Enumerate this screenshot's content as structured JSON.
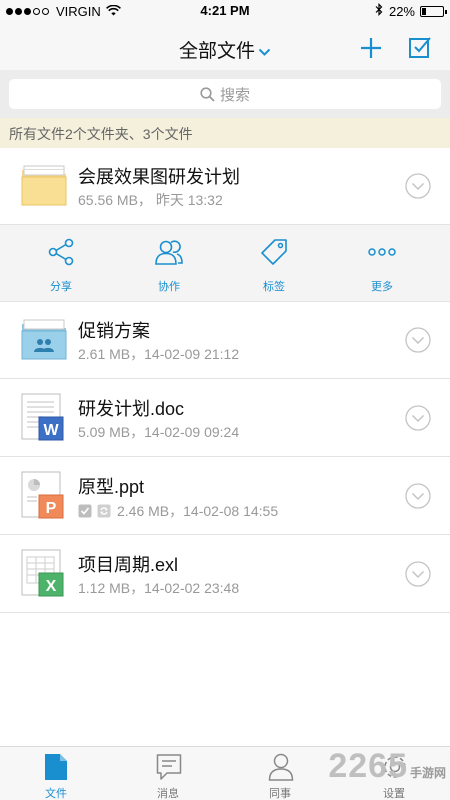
{
  "status_bar": {
    "carrier": "VIRGIN",
    "time": "4:21 PM",
    "battery": "22%"
  },
  "nav": {
    "title": "全部文件",
    "accent": "#1a8fd0"
  },
  "search": {
    "placeholder": "搜索"
  },
  "summary": "所有文件2个文件夹、3个文件",
  "files": [
    {
      "name": "会展效果图研发计划",
      "meta": "65.56 MB，  昨天 13:32",
      "type": "folder-icon"
    },
    {
      "name": "促销方案",
      "meta": "2.61 MB，14-02-09  21:12",
      "type": "shared-folder-icon"
    },
    {
      "name": "研发计划.doc",
      "meta": "5.09 MB，14-02-09  09:24",
      "type": "word-file-icon"
    },
    {
      "name": "原型.ppt",
      "meta": "2.46 MB，14-02-08 14:55",
      "type": "ppt-file-icon"
    },
    {
      "name": "项目周期.exl",
      "meta": "1.12 MB，14-02-02  23:48",
      "type": "excel-file-icon"
    }
  ],
  "actions": [
    {
      "label": "分享",
      "icon": "share-icon"
    },
    {
      "label": "协作",
      "icon": "collaborate-icon"
    },
    {
      "label": "标签",
      "icon": "tag-icon"
    },
    {
      "label": "更多",
      "icon": "more-icon"
    }
  ],
  "tabs": [
    {
      "label": "文件",
      "icon": "file-icon"
    },
    {
      "label": "消息",
      "icon": "message-icon"
    },
    {
      "label": "同事",
      "icon": "contacts-icon"
    },
    {
      "label": "设置",
      "icon": "settings-icon"
    }
  ],
  "watermark": {
    "number": "2265",
    "text": "手游网"
  }
}
